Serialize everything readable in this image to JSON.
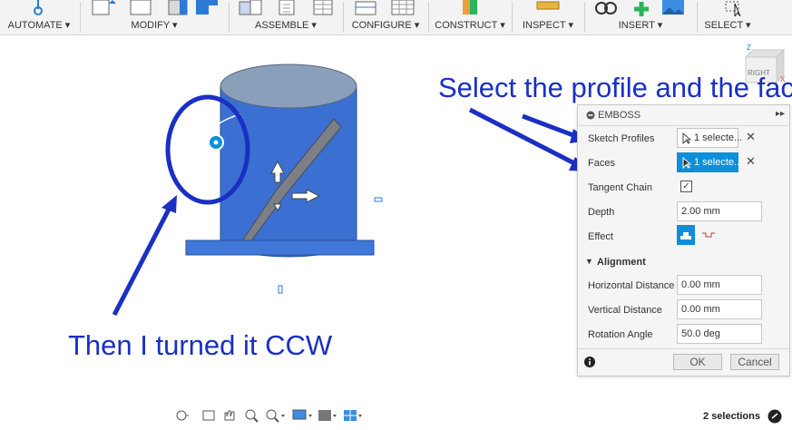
{
  "toolbar": {
    "groups": [
      {
        "label": "AUTOMATE ▾"
      },
      {
        "label": "MODIFY ▾"
      },
      {
        "label": "ASSEMBLE ▾"
      },
      {
        "label": "CONFIGURE ▾"
      },
      {
        "label": "CONSTRUCT ▾"
      },
      {
        "label": "INSPECT ▾"
      },
      {
        "label": "INSERT ▾"
      },
      {
        "label": "SELECT ▾"
      }
    ]
  },
  "viewcube": {
    "label": "RIGHT",
    "axis_z": "Z",
    "axis_x": "X"
  },
  "annotations": {
    "select_text": "Select the profile and the face.",
    "turned_text": "Then I turned it CCW"
  },
  "emboss": {
    "title": "EMBOSS",
    "sketch_profiles_label": "Sketch Profiles",
    "sketch_profiles_value": "1 selecte...",
    "faces_label": "Faces",
    "faces_value": "1 selecte...",
    "tangent_chain_label": "Tangent Chain",
    "tangent_chain_checked": true,
    "depth_label": "Depth",
    "depth_value": "2.00 mm",
    "effect_label": "Effect",
    "alignment_label": "Alignment",
    "horizontal_label": "Horizontal Distance",
    "horizontal_value": "0.00 mm",
    "vertical_label": "Vertical Distance",
    "vertical_value": "0.00 mm",
    "rotation_label": "Rotation Angle",
    "rotation_value": "50.0 deg",
    "ok_label": "OK",
    "cancel_label": "Cancel"
  },
  "status": {
    "selections": "2 selections"
  },
  "colors": {
    "annotation": "#1a2fc4",
    "cylinder": "#3b6fd1",
    "accent": "#0e8fd9"
  }
}
